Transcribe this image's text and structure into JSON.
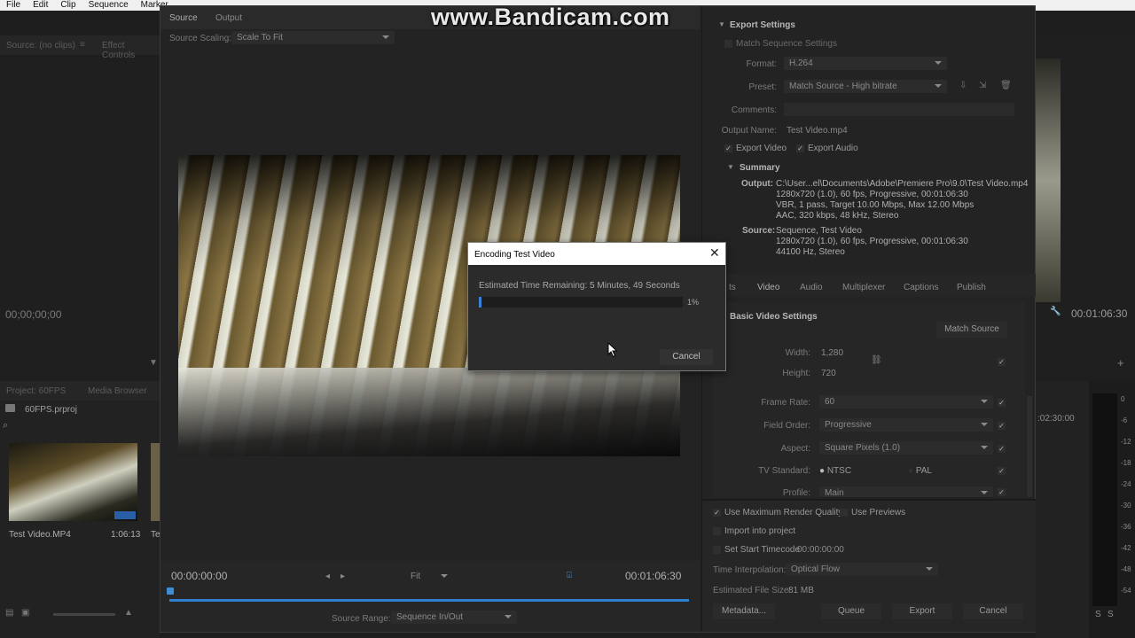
{
  "menubar": [
    "File",
    "Edit",
    "Clip",
    "Sequence",
    "Marker"
  ],
  "watermark": "www.Bandicam.com",
  "left_panel": {
    "source_tab": "Source: (no clips)",
    "effect_controls_tab": "Effect Controls",
    "timecode": "00;00;00;00",
    "project_tab": "Project: 60FPS",
    "media_browser_tab": "Media Browser",
    "project_file": "60FPS.prproj",
    "clip_name": "Test Video.MP4",
    "clip_duration": "1:06:13",
    "clip2_name": "Te"
  },
  "export": {
    "tabs": {
      "source": "Source",
      "output": "Output"
    },
    "source_scaling_label": "Source Scaling:",
    "source_scaling_value": "Scale To Fit",
    "tc_start": "00:00:00:00",
    "fit": "Fit",
    "tc_end": "00:01:06:30",
    "source_range_label": "Source Range:",
    "source_range_value": "Sequence In/Out",
    "settings": {
      "title": "Export Settings",
      "match_sequence": "Match Sequence Settings",
      "format_label": "Format:",
      "format_value": "H.264",
      "preset_label": "Preset:",
      "preset_value": "Match Source - High bitrate",
      "comments_label": "Comments:",
      "output_name_label": "Output Name:",
      "output_name_value": "Test Video.mp4",
      "export_video": "Export Video",
      "export_audio": "Export Audio",
      "summary_title": "Summary",
      "output_label": "Output:",
      "output_lines": [
        "C:\\User...el\\Documents\\Adobe\\Premiere Pro\\9.0\\Test Video.mp4",
        "1280x720 (1.0), 60 fps, Progressive, 00:01:06:30",
        "VBR, 1 pass, Target 10.00 Mbps, Max 12.00 Mbps",
        "AAC, 320 kbps, 48 kHz, Stereo"
      ],
      "source_label": "Source:",
      "source_lines": [
        "Sequence, Test Video",
        "1280x720 (1.0), 60 fps, Progressive, 00:01:06:30",
        "44100 Hz, Stereo"
      ],
      "tabs": [
        "ts",
        "Video",
        "Audio",
        "Multiplexer",
        "Captions",
        "Publish"
      ],
      "basic_video": "Basic Video Settings",
      "match_source": "Match Source",
      "width_label": "Width:",
      "width_value": "1,280",
      "height_label": "Height:",
      "height_value": "720",
      "frame_rate_label": "Frame Rate:",
      "frame_rate_value": "60",
      "field_order_label": "Field Order:",
      "field_order_value": "Progressive",
      "aspect_label": "Aspect:",
      "aspect_value": "Square Pixels (1.0)",
      "tv_standard_label": "TV Standard:",
      "ntsc": "NTSC",
      "pal": "PAL",
      "profile_label": "Profile:",
      "profile_value": "Main"
    },
    "bottom": {
      "max_render": "Use Maximum Render Quality",
      "use_previews": "Use Previews",
      "import_project": "Import into project",
      "start_timecode_label": "Set Start Timecode",
      "start_timecode_value": "00:00:00:00",
      "interp_label": "Time Interpolation:",
      "interp_value": "Optical Flow",
      "file_size_label": "Estimated File Size:",
      "file_size_value": "81 MB",
      "metadata": "Metadata...",
      "queue": "Queue",
      "export": "Export",
      "cancel": "Cancel"
    }
  },
  "right_panel": {
    "timecode": "00:01:06:30",
    "ruler_time": ":02:30:00",
    "meter_ticks": [
      "0",
      "-6",
      "-12",
      "-18",
      "-24",
      "-30",
      "-36",
      "-42",
      "-48",
      "-54"
    ],
    "meter_ss": [
      "S",
      "S"
    ]
  },
  "dialog": {
    "title": "Encoding Test Video",
    "remaining": "Estimated Time Remaining: 5 Minutes, 49 Seconds",
    "progress_label": "1%",
    "progress_fraction": 0.01,
    "cancel": "Cancel"
  }
}
